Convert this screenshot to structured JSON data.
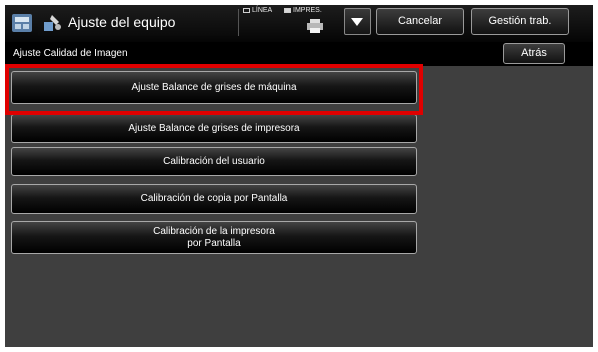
{
  "header": {
    "title": "Ajuste del equipo",
    "mode_linea": "LÍNEA",
    "mode_impres": "IMPRES.",
    "cancel_label": "Cancelar",
    "job_status_label": "Gestión trab."
  },
  "subheader": {
    "title": "Ajuste Calidad de Imagen",
    "back_label": "Atrás"
  },
  "menu": {
    "items": [
      {
        "label": "Ajuste Balance de grises de máquina",
        "selected": true
      },
      {
        "label": "Ajuste Balance de grises de impresora"
      },
      {
        "label": "Calibración del usuario"
      },
      {
        "label": "Calibración de copia por Pantalla"
      },
      {
        "label": "Calibración de la impresora\npor Pantalla"
      }
    ]
  },
  "colors": {
    "highlight": "#e00000",
    "screen_background": "#3f3f3f"
  },
  "icons": [
    "machine-settings-icon",
    "settings-tools-icon",
    "printer-icon",
    "dropdown-arrow-icon"
  ]
}
